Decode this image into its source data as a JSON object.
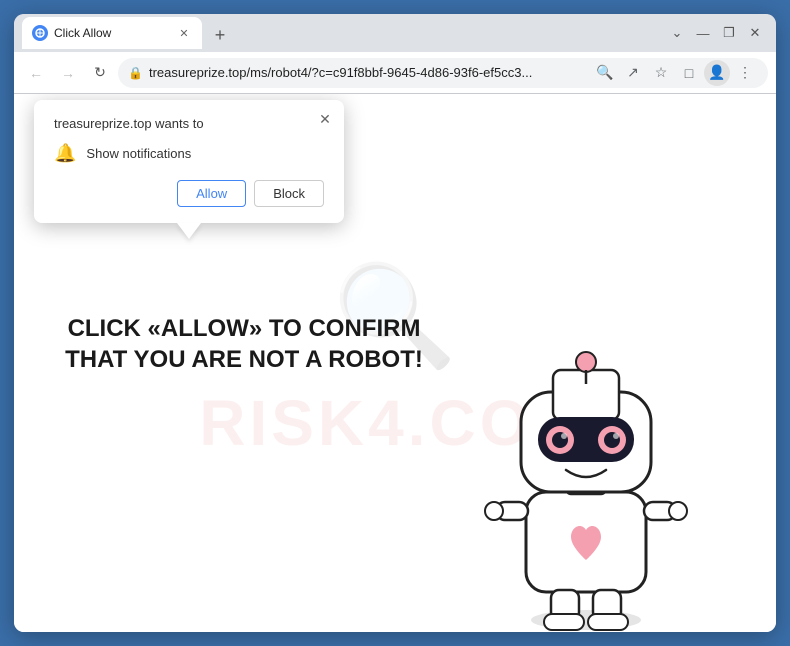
{
  "browser": {
    "tab": {
      "title": "Click Allow",
      "favicon_label": "globe-icon"
    },
    "new_tab_label": "+",
    "window_controls": {
      "chevron_down": "⌄",
      "minimize": "—",
      "restore": "❐",
      "close": "✕"
    },
    "nav": {
      "back": "←",
      "forward": "→",
      "reload": "↻"
    },
    "address": {
      "lock_icon": "🔒",
      "url": "treasureprize.top/ms/robot4/?c=c91f8bbf-9645-4d86-93f6-ef5cc3...",
      "search_icon": "🔍",
      "share_icon": "↗",
      "bookmark_icon": "☆",
      "extension_icon": "□",
      "profile_icon": "👤",
      "menu_icon": "⋮"
    }
  },
  "popup": {
    "title": "treasureprize.top wants to",
    "close_label": "✕",
    "permission_icon": "🔔",
    "permission_text": "Show notifications",
    "allow_label": "Allow",
    "block_label": "Block"
  },
  "webpage": {
    "main_text": "CLICK «ALLOW» TO CONFIRM THAT YOU ARE NOT A ROBOT!",
    "watermark_text": "RISK4.COM",
    "watermark_icon": "🔍"
  },
  "colors": {
    "browser_bg": "#dee1e6",
    "tab_bg": "#ffffff",
    "allow_border": "#4285f4",
    "allow_text": "#4285f4",
    "main_text_color": "#1a1a1a",
    "watermark_color": "#e88080"
  }
}
